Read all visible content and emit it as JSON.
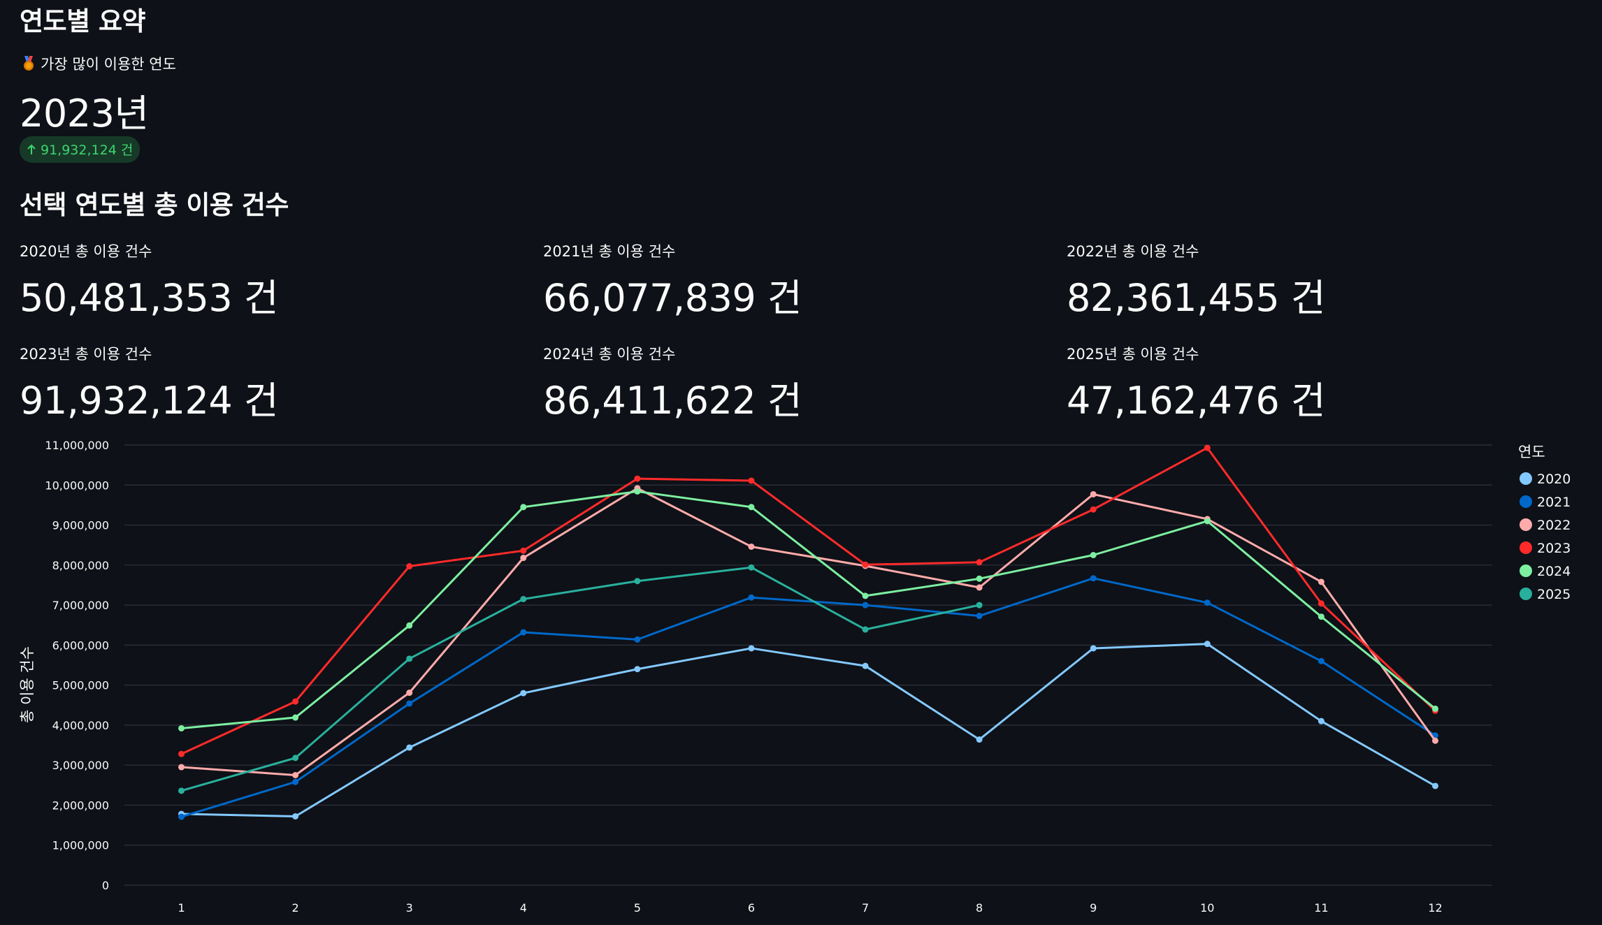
{
  "summary": {
    "heading": "연도별 요약",
    "top_label": "가장 많이 이용한 연도",
    "top_year": "2023년",
    "top_delta": "91,932,124 건"
  },
  "totals": {
    "heading": "선택 연도별 총 이용 건수",
    "items": [
      {
        "label": "2020년 총 이용 건수",
        "value": "50,481,353 건"
      },
      {
        "label": "2021년 총 이용 건수",
        "value": "66,077,839 건"
      },
      {
        "label": "2022년 총 이용 건수",
        "value": "82,361,455 건"
      },
      {
        "label": "2023년 총 이용 건수",
        "value": "91,932,124 건"
      },
      {
        "label": "2024년 총 이용 건수",
        "value": "86,411,622 건"
      },
      {
        "label": "2025년 총 이용 건수",
        "value": "47,162,476 건"
      }
    ]
  },
  "chart_data": {
    "type": "line",
    "title": "",
    "xlabel": "",
    "ylabel": "총 이용 건수",
    "x": [
      1,
      2,
      3,
      4,
      5,
      6,
      7,
      8,
      9,
      10,
      11,
      12
    ],
    "ylim": [
      0,
      11000000
    ],
    "yticks": [
      0,
      1000000,
      2000000,
      3000000,
      4000000,
      5000000,
      6000000,
      7000000,
      8000000,
      9000000,
      10000000,
      11000000
    ],
    "ytick_labels": [
      "0",
      "1,000,000",
      "2,000,000",
      "3,000,000",
      "4,000,000",
      "5,000,000",
      "6,000,000",
      "7,000,000",
      "8,000,000",
      "9,000,000",
      "10,000,000",
      "11,000,000"
    ],
    "grid": true,
    "legend_title": "연도",
    "legend_position": "right",
    "series": [
      {
        "name": "2020",
        "color": "#83c9ff",
        "values": [
          1780000,
          1720000,
          3440000,
          4800000,
          5400000,
          5920000,
          5480000,
          3640000,
          5920000,
          6030000,
          4100000,
          2480000
        ]
      },
      {
        "name": "2021",
        "color": "#0068c9",
        "values": [
          1710000,
          2580000,
          4540000,
          6320000,
          6140000,
          7190000,
          7000000,
          6730000,
          7670000,
          7060000,
          5600000,
          3740000
        ]
      },
      {
        "name": "2022",
        "color": "#ffabab",
        "values": [
          2950000,
          2750000,
          4810000,
          8180000,
          9920000,
          8460000,
          7980000,
          7440000,
          9770000,
          9150000,
          7580000,
          3610000
        ]
      },
      {
        "name": "2023",
        "color": "#ff2b2b",
        "values": [
          3280000,
          4590000,
          7970000,
          8360000,
          10160000,
          10110000,
          8010000,
          8070000,
          9390000,
          10930000,
          7040000,
          4360000
        ]
      },
      {
        "name": "2024",
        "color": "#7defa1",
        "values": [
          3920000,
          4190000,
          6490000,
          9450000,
          9840000,
          9450000,
          7230000,
          7660000,
          8250000,
          9100000,
          6710000,
          4410000
        ]
      },
      {
        "name": "2025",
        "color": "#29b09d",
        "values": [
          2360000,
          3180000,
          5660000,
          7150000,
          7600000,
          7940000,
          6390000,
          7000000,
          null,
          null,
          null,
          null
        ]
      }
    ]
  }
}
